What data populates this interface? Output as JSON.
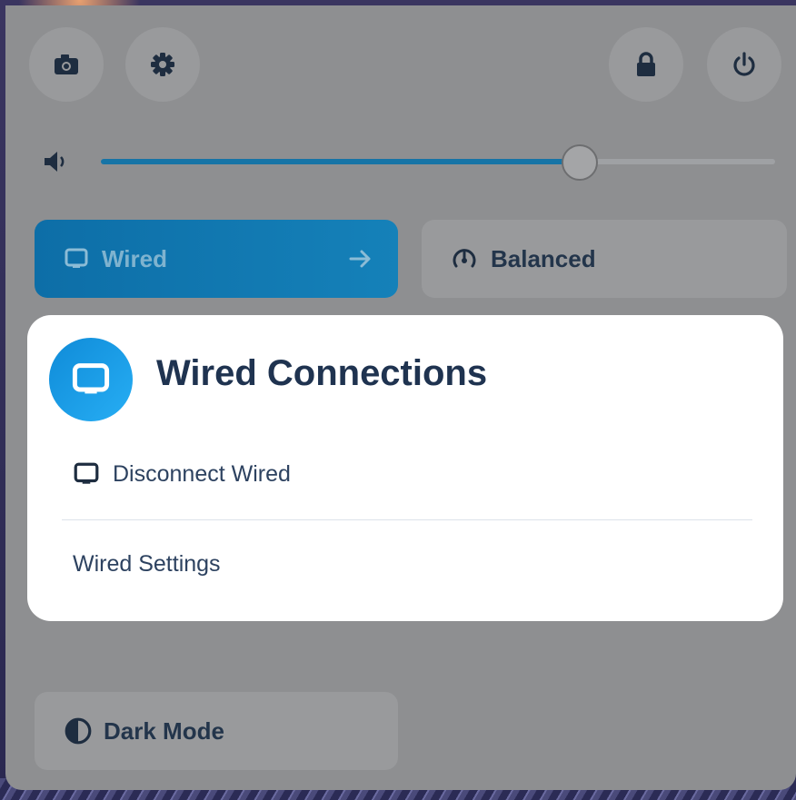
{
  "quick_settings": {
    "top_buttons": [
      {
        "name": "screenshot",
        "icon": "camera-icon"
      },
      {
        "name": "settings",
        "icon": "gear-icon"
      },
      {
        "name": "lock",
        "icon": "lock-icon"
      },
      {
        "name": "power",
        "icon": "power-icon"
      }
    ],
    "volume": {
      "icon": "speaker-icon",
      "level": 0.71
    },
    "tiles": {
      "wired_label": "Wired",
      "balanced_label": "Balanced",
      "dark_mode_label": "Dark Mode"
    }
  },
  "wired_menu": {
    "title": "Wired Connections",
    "items": [
      "Disconnect Wired",
      "Wired Settings"
    ]
  },
  "colors": {
    "accent": "#1674a6",
    "menu_icon": "#1a9ae6",
    "text_dark": "#1f3350"
  }
}
